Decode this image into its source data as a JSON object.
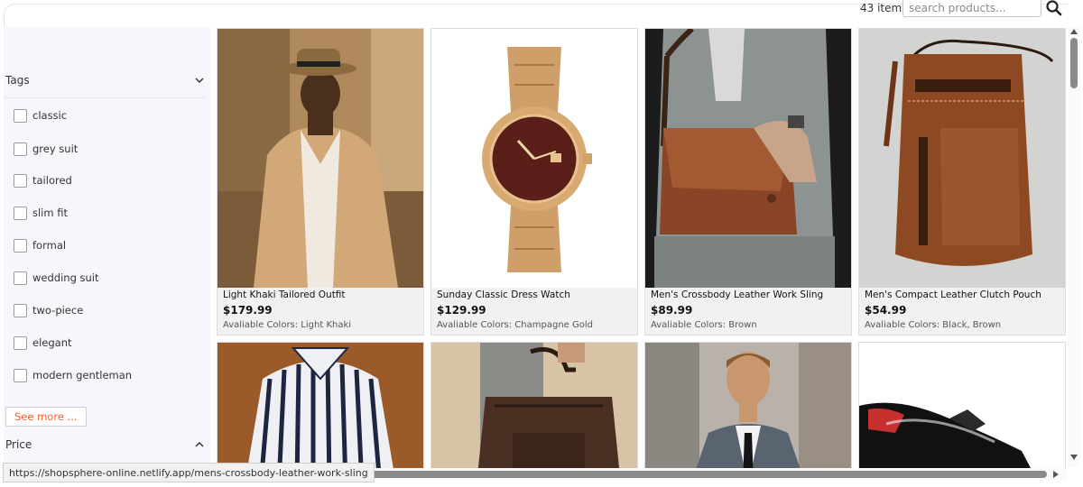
{
  "toolbar": {
    "count_text": "43 items",
    "search_placeholder": "search products...",
    "search_icon": "search-icon"
  },
  "sidebar": {
    "tags_title": "Tags",
    "tags": [
      {
        "label": "classic",
        "checked": false
      },
      {
        "label": "grey suit",
        "checked": false
      },
      {
        "label": "tailored",
        "checked": false
      },
      {
        "label": "slim fit",
        "checked": false
      },
      {
        "label": "formal",
        "checked": false
      },
      {
        "label": "wedding suit",
        "checked": false
      },
      {
        "label": "two-piece",
        "checked": false
      },
      {
        "label": "elegant",
        "checked": false
      },
      {
        "label": "modern gentleman",
        "checked": false
      }
    ],
    "see_more_label": "See more ...",
    "price_title": "Price",
    "accent_color": "#ff5a1f"
  },
  "products": [
    {
      "name": "Light Khaki Tailored Outfit",
      "price": "$179.99",
      "colors": "Avaliable Colors: Light Khaki",
      "image": "man-in-khaki-suit-photo"
    },
    {
      "name": "Sunday Classic Dress Watch",
      "price": "$129.99",
      "colors": "Avaliable Colors: Champagne Gold",
      "image": "gold-watch-photo"
    },
    {
      "name": "Men's Crossbody Leather Work Sling",
      "price": "$89.99",
      "colors": "Avaliable Colors: Brown",
      "image": "leather-messenger-bag-photo"
    },
    {
      "name": "Men's Compact Leather Clutch Pouch",
      "price": "$54.99",
      "colors": "Avaliable Colors: Black, Brown",
      "image": "leather-pouch-photo"
    },
    {
      "name": "",
      "price": "",
      "colors": "",
      "image": "striped-shirt-photo"
    },
    {
      "name": "",
      "price": "",
      "colors": "",
      "image": "leather-tote-bag-photo"
    },
    {
      "name": "",
      "price": "",
      "colors": "",
      "image": "man-in-grey-suit-photo"
    },
    {
      "name": "",
      "price": "",
      "colors": "",
      "image": "patent-leather-shoes-photo"
    }
  ],
  "status_bar": {
    "url": "https://shopsphere-online.netlify.app/mens-crossbody-leather-work-sling"
  }
}
